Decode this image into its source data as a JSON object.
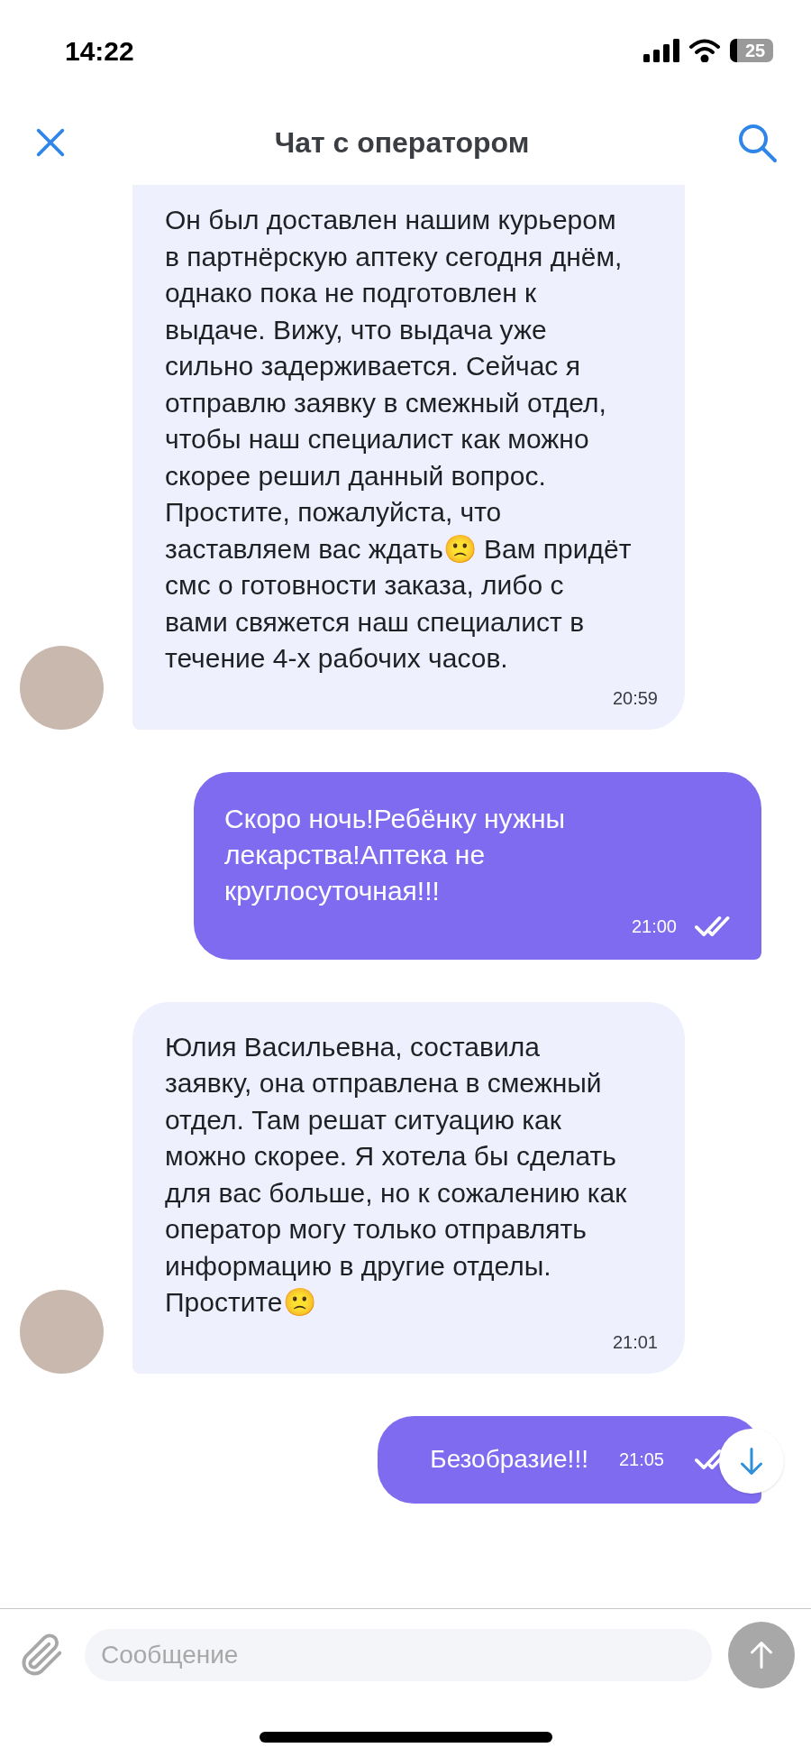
{
  "status_bar": {
    "time": "14:22",
    "battery": "25"
  },
  "header": {
    "title": "Чат с оператором"
  },
  "messages": [
    {
      "kind": "incoming",
      "clipped_top": true,
      "text": "Он был доставлен нашим курьером в партнёрскую аптеку сегодня днём, однако пока не подготовлен к выдаче. Вижу, что выдача уже сильно задерживается. Сейчас я отправлю заявку в смежный отдел, чтобы наш специалист как можно скорее решил данный вопрос. Простите, пожалуйста, что заставляем вас ждать🙁 Вам придёт смс о готовности заказа, либо с вами свяжется наш специалист в течение 4-х рабочих часов.",
      "time": "20:59"
    },
    {
      "kind": "outgoing",
      "text": "Скоро ночь!Ребёнку нужны лекарства!Аптека не круглосуточная!!!",
      "time": "21:00"
    },
    {
      "kind": "incoming",
      "clipped_top": false,
      "text": "Юлия Васильевна, составила заявку, она отправлена в смежный отдел. Там решат ситуацию как можно скорее. Я хотела бы сделать для вас больше, но к сожалению как оператор могу только отправлять информацию в другие отделы. Простите🙁",
      "time": "21:01"
    },
    {
      "kind": "outgoing_short",
      "text": "Безобразие!!!",
      "time": "21:05"
    }
  ],
  "composer": {
    "placeholder": "Сообщение"
  }
}
